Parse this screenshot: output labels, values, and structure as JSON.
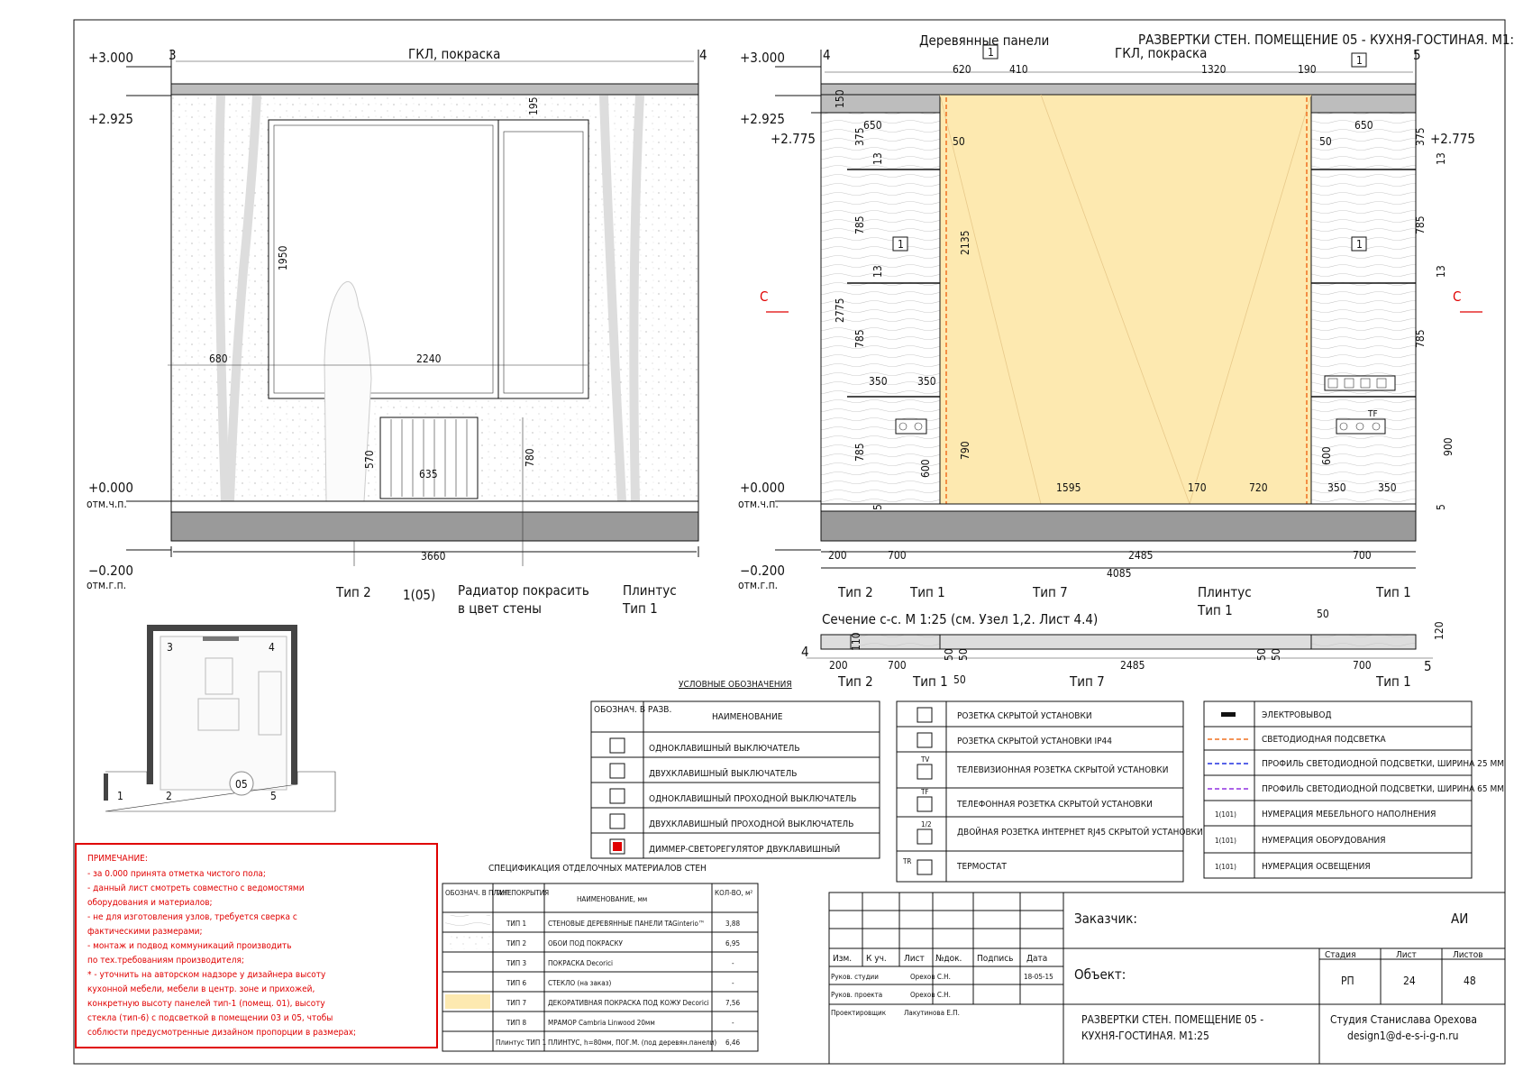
{
  "sheet_title": "РАЗВЕРТКИ СТЕН. ПОМЕЩЕНИЕ 05 - КУХНЯ-ГОСТИНАЯ. М1:25",
  "left_view": {
    "ceiling_note": "ГКЛ, покраска",
    "axis_left": "3",
    "axis_right": "4",
    "levels": {
      "l3000": "+3.000",
      "l2925": "+2.925",
      "l0": "+0.000",
      "l0_sub": "отм.ч.п.",
      "lm200": "−0.200",
      "lm200_sub": "отм.г.п."
    },
    "dims": {
      "d195": "195",
      "d1950": "1950",
      "d680": "680",
      "d2240": "2240",
      "d570": "570",
      "d635": "635",
      "d780": "780",
      "d3660": "3660"
    },
    "callouts": {
      "type2": "Тип 2",
      "ref": "1(05)",
      "radiator_1": "Радиатор покрасить",
      "radiator_2": "в цвет стены",
      "plinth": "Плинтус",
      "plinth_type": "Тип 1"
    }
  },
  "right_view": {
    "wood_note": "Деревянные панели",
    "ceiling_note": "ГКЛ, покраска",
    "axis_left": "4",
    "axis_right": "5",
    "levels": {
      "l3000": "+3.000",
      "l2925": "+2.925",
      "l2775": "+2.775",
      "l2775r": "+2.775",
      "l0": "+0.000",
      "l0_sub": "отм.ч.п.",
      "lm200": "−0.200",
      "lm200_sub": "отм.г.п."
    },
    "dims": {
      "d620": "620",
      "d410": "410",
      "d1320": "1320",
      "d190": "190",
      "d150": "150",
      "d650a": "650",
      "d650b": "650",
      "d50a": "50",
      "d50b": "50",
      "d375a": "375",
      "d375b": "375",
      "d13a": "13",
      "d13b": "13",
      "d13c": "13",
      "d13d": "13",
      "d785a": "785",
      "d785b": "785",
      "d785c": "785",
      "d785d": "785",
      "d785e": "785",
      "d2135": "2135",
      "d2775": "2775",
      "d350a": "350",
      "d350b": "350",
      "d790": "790",
      "d600a": "600",
      "d600b": "600",
      "d900": "900",
      "d1595": "1595",
      "d170": "170",
      "d720": "720",
      "d350c": "350",
      "d350d": "350",
      "d5a": "5",
      "d5b": "5",
      "d200": "200",
      "d700a": "700",
      "d2485": "2485",
      "d700b": "700",
      "d4085": "4085"
    },
    "markers": {
      "m1a": "1",
      "m1b": "1",
      "m1c": "1",
      "m1d": "1",
      "cut_left": "С",
      "cut_right": "С",
      "tf": "TF"
    },
    "callouts": {
      "t2": "Тип 2",
      "t1a": "Тип 1",
      "t7": "Тип 7",
      "plinth": "Плинтус",
      "plinth_type": "Тип 1",
      "t1b": "Тип 1"
    }
  },
  "section": {
    "title": "Сечение с-с. М 1:25 (см. Узел 1,2. Лист 4.4)",
    "axis_left": "4",
    "axis_right": "5",
    "dims": {
      "d200": "200",
      "d700a": "700",
      "d50a": "50",
      "d50b": "50",
      "d2485": "2485",
      "d50c": "50",
      "d50d": "50",
      "d700b": "700",
      "d50top": "50",
      "d110": "110",
      "d120": "120",
      "d50bot": "50"
    },
    "callouts": {
      "t2": "Тип 2",
      "t1a": "Тип 1",
      "t7": "Тип 7",
      "t1b": "Тип 1"
    }
  },
  "plan": {
    "room": "05",
    "a3": "3",
    "a4": "4",
    "a1": "1",
    "a2": "2",
    "a5": "5"
  },
  "legend_title": "УСЛОВНЫЕ ОБОЗНАЧЕНИЯ",
  "legend1": {
    "head_symbol": "ОБОЗНАЧ. В РАЗВ.",
    "head_name": "НАИМЕНОВАНИЕ",
    "rows": [
      "ОДНОКЛАВИШНЫЙ ВЫКЛЮЧАТЕЛЬ",
      "ДВУХКЛАВИШНЫЙ ВЫКЛЮЧАТЕЛЬ",
      "ОДНОКЛАВИШНЫЙ ПРОХОДНОЙ ВЫКЛЮЧАТЕЛЬ",
      "ДВУХКЛАВИШНЫЙ ПРОХОДНОЙ ВЫКЛЮЧАТЕЛЬ",
      "ДИММЕР-СВЕТОРЕГУЛЯТОР ДВУКЛАВИШНЫЙ"
    ]
  },
  "legend2": {
    "rows": [
      "РОЗЕТКА СКРЫТОЙ УСТАНОВКИ",
      "РОЗЕТКА СКРЫТОЙ УСТАНОВКИ IP44",
      "ТЕЛЕВИЗИОННАЯ РОЗЕТКА СКРЫТОЙ УСТАНОВКИ",
      "ТЕЛЕФОННАЯ РОЗЕТКА СКРЫТОЙ УСТАНОВКИ",
      "ДВОЙНАЯ РОЗЕТКА ИНТЕРНЕТ RJ45 СКРЫТОЙ УСТАНОВКИ",
      "ТЕРМОСТАТ"
    ],
    "tags": [
      "TV",
      "TF",
      "1/2",
      "TR"
    ]
  },
  "legend3": {
    "rows": [
      "ЭЛЕКТРОВЫВОД",
      "СВЕТОДИОДНАЯ ПОДСВЕТКА",
      "ПРОФИЛЬ СВЕТОДИОДНОЙ ПОДСВЕТКИ, ШИРИНА 25 ММ",
      "ПРОФИЛЬ СВЕТОДИОДНОЙ ПОДСВЕТКИ, ШИРИНА 65 ММ",
      "НУМЕРАЦИЯ МЕБЕЛЬНОГО НАПОЛНЕНИЯ",
      "НУМЕРАЦИЯ ОБОРУДОВАНИЯ",
      "НУМЕРАЦИЯ ОСВЕЩЕНИЯ"
    ],
    "badge": "1(101)",
    "colors": {
      "led": "#f07020",
      "profile25": "#2030e0",
      "profile65": "#9030e0"
    }
  },
  "note": {
    "title": "ПРИМЕЧАНИЕ:",
    "lines": [
      "- за 0.000 принята отметка чистого пола;",
      "- данный лист смотреть совместно с ведомостями",
      "оборудования и материалов;",
      "- не для изготовления узлов, требуется сверка с",
      "фактическими размерами;",
      "- монтаж и подвод коммуникаций производить",
      "по тех.требованиям производителя;",
      "* - уточнить на авторском надзоре у дизайнера высоту",
      "кухонной мебели, мебели в центр. зоне и прихожей,",
      "конкретную высоту панелей тип-1 (помещ. 01), высоту",
      "стекла (тип-6) с подсветкой в помещении 03 и 05, чтобы",
      "соблюсти предусмотренные дизайном пропорции в размерах;"
    ],
    "color": "#e00000"
  },
  "spec": {
    "title": "СПЕЦИФИКАЦИЯ ОТДЕЛОЧНЫХ МАТЕРИАЛОВ СТЕН",
    "head": [
      "ОБОЗНАЧ. В ПЛАНЕ",
      "ТИП ПОКРЫТИЯ",
      "НАИМЕНОВАНИЕ, мм",
      "КОЛ-ВО, м²"
    ],
    "rows": [
      {
        "type": "ТИП 1",
        "name": "СТЕНОВЫЕ ДЕРЕВЯННЫЕ ПАНЕЛИ TAGinterio™",
        "qty": "3,88"
      },
      {
        "type": "ТИП 2",
        "name": "ОБОИ ПОД ПОКРАСКУ",
        "qty": "6,95"
      },
      {
        "type": "ТИП 3",
        "name": "ПОКРАСКА Decorici",
        "qty": "-"
      },
      {
        "type": "ТИП 6",
        "name": "СТЕКЛО (на заказ)",
        "qty": "-"
      },
      {
        "type": "ТИП 7",
        "name": "ДЕКОРАТИВНАЯ ПОКРАСКА ПОД КОЖУ Decorici",
        "qty": "7,56"
      },
      {
        "type": "ТИП 8",
        "name": "МРАМОР Cambria Linwood 20мм",
        "qty": "-"
      },
      {
        "type": "Плинтус ТИП 1",
        "name": "ПЛИНТУС, h=80мм, ПОГ.М. (под деревян.панели)",
        "qty": "6,46"
      }
    ]
  },
  "stamp": {
    "customer_label": "Заказчик:",
    "customer": "АИ",
    "object_label": "Объект:",
    "cols": [
      "Изм.",
      "К уч.",
      "Лист",
      "№док.",
      "Подпись",
      "Дата"
    ],
    "people": [
      {
        "role": "Руков. студии",
        "name": "Орехов С.Н.",
        "date": "18-05-15"
      },
      {
        "role": "Руков. проекта",
        "name": "Орехов С.Н.",
        "date": ""
      },
      {
        "role": "Проектировщик",
        "name": "Лакутинова Е.П.",
        "date": ""
      }
    ],
    "stage_label": "Стадия",
    "sheet_label": "Лист",
    "sheets_label": "Листов",
    "stage": "РП",
    "sheet": "24",
    "sheets": "48",
    "title_1": "РАЗВЕРТКИ СТЕН. ПОМЕЩЕНИЕ 05 -",
    "title_2": "КУХНЯ-ГОСТИНАЯ. М1:25",
    "studio": "Студия Станислава Орехова",
    "email": "design1@d-e-s-i-g-n.ru"
  }
}
